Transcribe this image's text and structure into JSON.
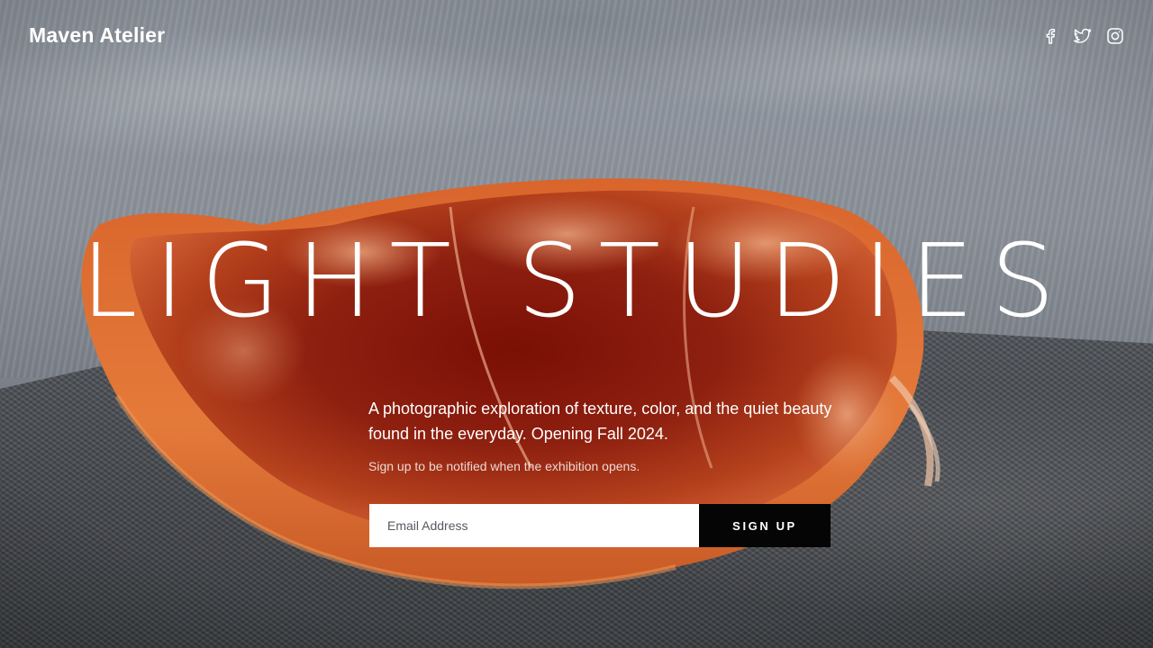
{
  "brand": {
    "name": "Maven Atelier"
  },
  "socials": [
    {
      "icon": "facebook-icon"
    },
    {
      "icon": "twitter-icon"
    },
    {
      "icon": "instagram-icon"
    }
  ],
  "hero": {
    "title": "LIGHT STUDIES",
    "intro": "A photographic exploration of texture, color, and the quiet beauty found in the everyday. Opening Fall 2024.",
    "note": "Sign up to be notified when the exhibition opens."
  },
  "signup": {
    "email_placeholder": "Email Address",
    "button_label": "SIGN UP"
  },
  "colors": {
    "text": "#ffffff",
    "button_bg": "#050505",
    "input_bg": "#ffffff",
    "fruit_flesh": "#8c1f0c",
    "fruit_rind": "#e06a2c"
  }
}
